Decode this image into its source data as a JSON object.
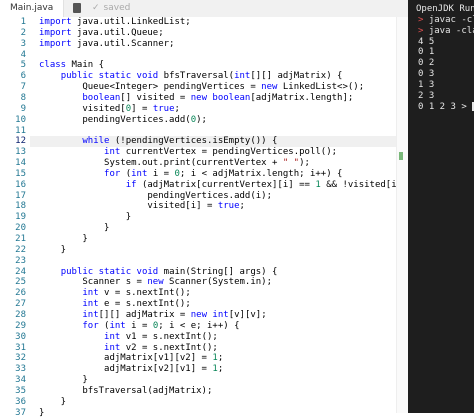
{
  "tab": {
    "filename": "Main.java",
    "saved_label": "saved",
    "saved_icon": "check-icon"
  },
  "editor": {
    "line_numbers": [
      "1",
      "2",
      "3",
      "4",
      "5",
      "6",
      "7",
      "8",
      "9",
      "10",
      "11",
      "12",
      "13",
      "14",
      "15",
      "16",
      "17",
      "18",
      "19",
      "20",
      "21",
      "22",
      "23",
      "24",
      "25",
      "26",
      "27",
      "28",
      "29",
      "30",
      "31",
      "32",
      "33",
      "34",
      "35",
      "36",
      "37"
    ],
    "current_line": 12
  },
  "terminal": {
    "title": "OpenJDK Runt",
    "commands": [
      "javac -cla",
      "java -clas"
    ],
    "output": [
      "4 5",
      "0 1",
      "0 2",
      "0 3",
      "1 3",
      "2 3",
      "0 1 2 3 > "
    ]
  }
}
